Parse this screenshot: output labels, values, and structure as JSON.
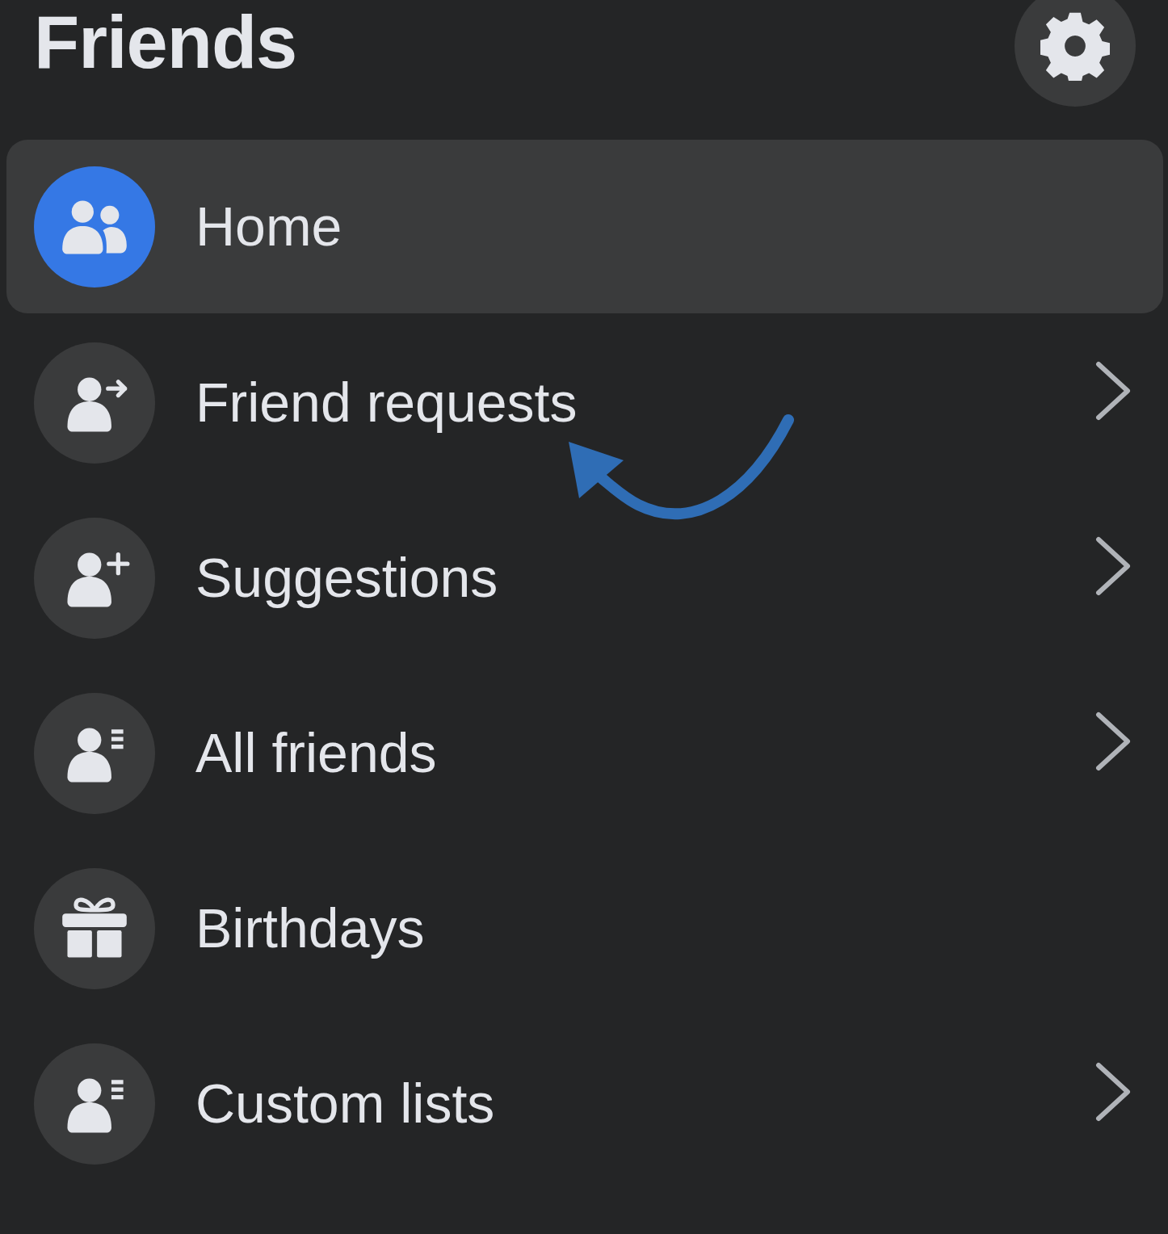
{
  "header": {
    "title": "Friends"
  },
  "items": [
    {
      "label": "Home",
      "selected": true,
      "chevron": false
    },
    {
      "label": "Friend requests",
      "selected": false,
      "chevron": true
    },
    {
      "label": "Suggestions",
      "selected": false,
      "chevron": true
    },
    {
      "label": "All friends",
      "selected": false,
      "chevron": true
    },
    {
      "label": "Birthdays",
      "selected": false,
      "chevron": false
    },
    {
      "label": "Custom lists",
      "selected": false,
      "chevron": true
    }
  ]
}
